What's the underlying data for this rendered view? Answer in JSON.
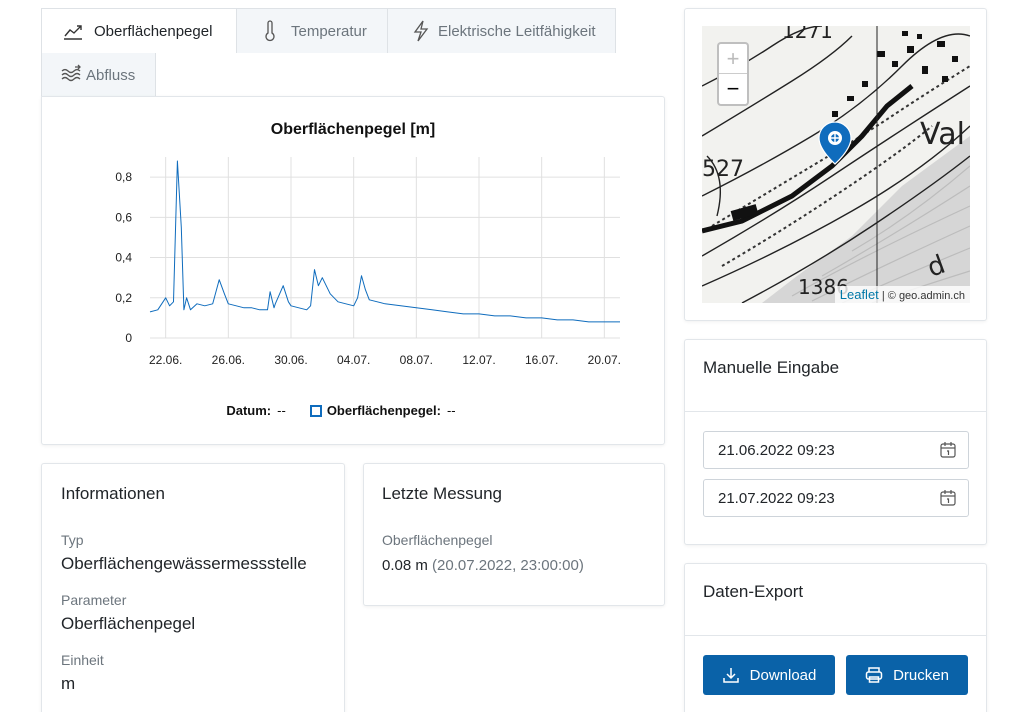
{
  "tabs": [
    {
      "label": "Oberflächenpegel",
      "icon": "line-chart-icon",
      "active": true
    },
    {
      "label": "Temperatur",
      "icon": "thermometer-icon",
      "active": false
    },
    {
      "label": "Elektrische Leitfähigkeit",
      "icon": "lightning-icon",
      "active": false
    },
    {
      "label": "Abfluss",
      "icon": "flow-waves-icon",
      "active": false
    }
  ],
  "chart": {
    "title": "Oberflächenpegel [m]",
    "legend_date_label": "Datum:",
    "legend_date_value": "--",
    "legend_series_label": "Oberflächenpegel:",
    "legend_series_value": "--"
  },
  "chart_data": {
    "type": "line",
    "title": "Oberflächenpegel [m]",
    "xlabel": "",
    "ylabel": "",
    "x_tick_labels": [
      "22.06.",
      "26.06.",
      "30.06.",
      "04.07.",
      "08.07.",
      "12.07.",
      "16.07.",
      "20.07."
    ],
    "y_tick_labels": [
      "0",
      "0,2",
      "0,4",
      "0,6",
      "0,8"
    ],
    "y_ticks": [
      0,
      0.2,
      0.4,
      0.6,
      0.8
    ],
    "ylim": [
      0,
      0.9
    ],
    "xlim": [
      "2022-06-21",
      "2022-07-21"
    ],
    "grid": true,
    "color": "#0f6cbd",
    "series": [
      {
        "name": "Oberflächenpegel",
        "points": [
          [
            "2022-06-21",
            0.13
          ],
          [
            "2022-06-21T12",
            0.14
          ],
          [
            "2022-06-22",
            0.2
          ],
          [
            "2022-06-22T06",
            0.16
          ],
          [
            "2022-06-22T12",
            0.18
          ],
          [
            "2022-06-22T18",
            0.88
          ],
          [
            "2022-06-23",
            0.55
          ],
          [
            "2022-06-23T04",
            0.14
          ],
          [
            "2022-06-23T08",
            0.2
          ],
          [
            "2022-06-23T14",
            0.14
          ],
          [
            "2022-06-24",
            0.17
          ],
          [
            "2022-06-24T12",
            0.16
          ],
          [
            "2022-06-25",
            0.17
          ],
          [
            "2022-06-25T10",
            0.29
          ],
          [
            "2022-06-25T18",
            0.22
          ],
          [
            "2022-06-26",
            0.17
          ],
          [
            "2022-06-26T12",
            0.16
          ],
          [
            "2022-06-27",
            0.15
          ],
          [
            "2022-06-27T12",
            0.15
          ],
          [
            "2022-06-28",
            0.14
          ],
          [
            "2022-06-28T12",
            0.14
          ],
          [
            "2022-06-28T16",
            0.23
          ],
          [
            "2022-06-28T22",
            0.15
          ],
          [
            "2022-06-29",
            0.17
          ],
          [
            "2022-06-29T12",
            0.26
          ],
          [
            "2022-06-29T20",
            0.18
          ],
          [
            "2022-06-30",
            0.16
          ],
          [
            "2022-06-30T12",
            0.15
          ],
          [
            "2022-07-01",
            0.14
          ],
          [
            "2022-07-01T06",
            0.16
          ],
          [
            "2022-07-01T12",
            0.34
          ],
          [
            "2022-07-01T18",
            0.26
          ],
          [
            "2022-07-02",
            0.3
          ],
          [
            "2022-07-02T12",
            0.22
          ],
          [
            "2022-07-03",
            0.18
          ],
          [
            "2022-07-03T12",
            0.17
          ],
          [
            "2022-07-04",
            0.16
          ],
          [
            "2022-07-04T06",
            0.2
          ],
          [
            "2022-07-04T12",
            0.31
          ],
          [
            "2022-07-04T18",
            0.24
          ],
          [
            "2022-07-05",
            0.19
          ],
          [
            "2022-07-06",
            0.17
          ],
          [
            "2022-07-07",
            0.16
          ],
          [
            "2022-07-08",
            0.15
          ],
          [
            "2022-07-09",
            0.14
          ],
          [
            "2022-07-10",
            0.13
          ],
          [
            "2022-07-11",
            0.12
          ],
          [
            "2022-07-12",
            0.12
          ],
          [
            "2022-07-13",
            0.11
          ],
          [
            "2022-07-14",
            0.11
          ],
          [
            "2022-07-15",
            0.1
          ],
          [
            "2022-07-16",
            0.1
          ],
          [
            "2022-07-17",
            0.09
          ],
          [
            "2022-07-18",
            0.09
          ],
          [
            "2022-07-19",
            0.08
          ],
          [
            "2022-07-20",
            0.08
          ],
          [
            "2022-07-21",
            0.08
          ]
        ]
      }
    ]
  },
  "info": {
    "header": "Informationen",
    "type_label": "Typ",
    "type_value": "Oberflächengewässermessstelle",
    "param_label": "Parameter",
    "param_value": "Oberflächenpegel",
    "unit_label": "Einheit",
    "unit_value": "m"
  },
  "last": {
    "header": "Letzte Messung",
    "label": "Oberflächenpegel",
    "value": "0.08 m",
    "timestamp": "(20.07.2022, 23:00:00)"
  },
  "map": {
    "zoom_in": "+",
    "zoom_out": "−",
    "leaflet": "Leaflet",
    "separator": "|",
    "copyright": "© geo.admin.ch",
    "labels": [
      "1271",
      "Val",
      "527",
      "1386",
      "d"
    ]
  },
  "manual": {
    "header": "Manuelle Eingabe",
    "start": "21.06.2022 09:23",
    "end": "21.07.2022 09:23"
  },
  "export": {
    "header": "Daten-Export",
    "download": "Download",
    "print": "Drucken"
  }
}
